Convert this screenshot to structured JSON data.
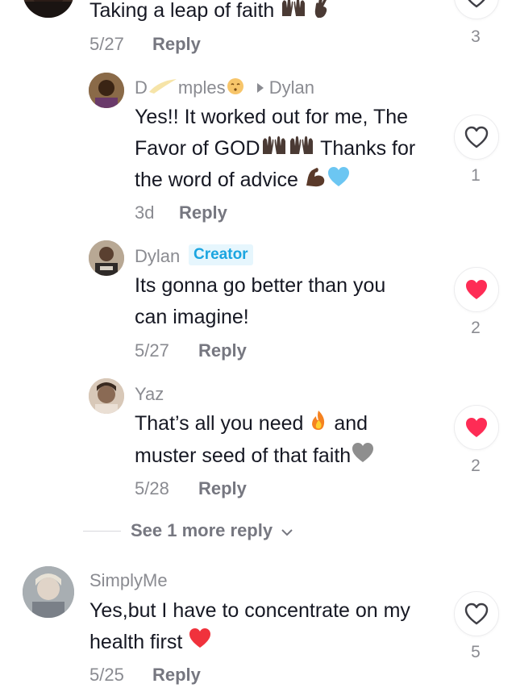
{
  "comment0": {
    "text": "Taking a leap of faith",
    "date": "5/27",
    "reply_label": "Reply",
    "likes": "3"
  },
  "reply1": {
    "name_part1": "D",
    "name_part2": "mples",
    "target": "Dylan",
    "text_line1": "Yes!! It worked out for me, The",
    "text_line2a": "Favor of GOD",
    "text_line2b": "Thanks for",
    "text_line3": "the word of advice",
    "date": "3d",
    "reply_label": "Reply",
    "likes": "1",
    "liked": false
  },
  "reply2": {
    "name": "Dylan",
    "badge": "Creator",
    "text_line1": "Its gonna go better than you",
    "text_line2": "can imagine!",
    "date": "5/27",
    "reply_label": "Reply",
    "likes": "2",
    "liked": true
  },
  "reply3": {
    "name": "Yaz",
    "text_line1a": "That’s all you need",
    "text_line1b": "and",
    "text_line2": "muster seed of that faith",
    "date": "5/28",
    "reply_label": "Reply",
    "likes": "2",
    "liked": true
  },
  "see_more": {
    "label": "See 1 more reply"
  },
  "comment4": {
    "name": "SimplyMe",
    "text_line1": "Yes,but I have to concentrate on my",
    "text_line2": "health first",
    "date": "5/25",
    "reply_label": "Reply",
    "likes": "5",
    "liked": false
  },
  "colors": {
    "like_red": "#fe2c55",
    "creator_badge_bg": "#e6f6fd",
    "creator_badge_text": "#1ba5e0",
    "muted_text": "#8a8b91"
  }
}
